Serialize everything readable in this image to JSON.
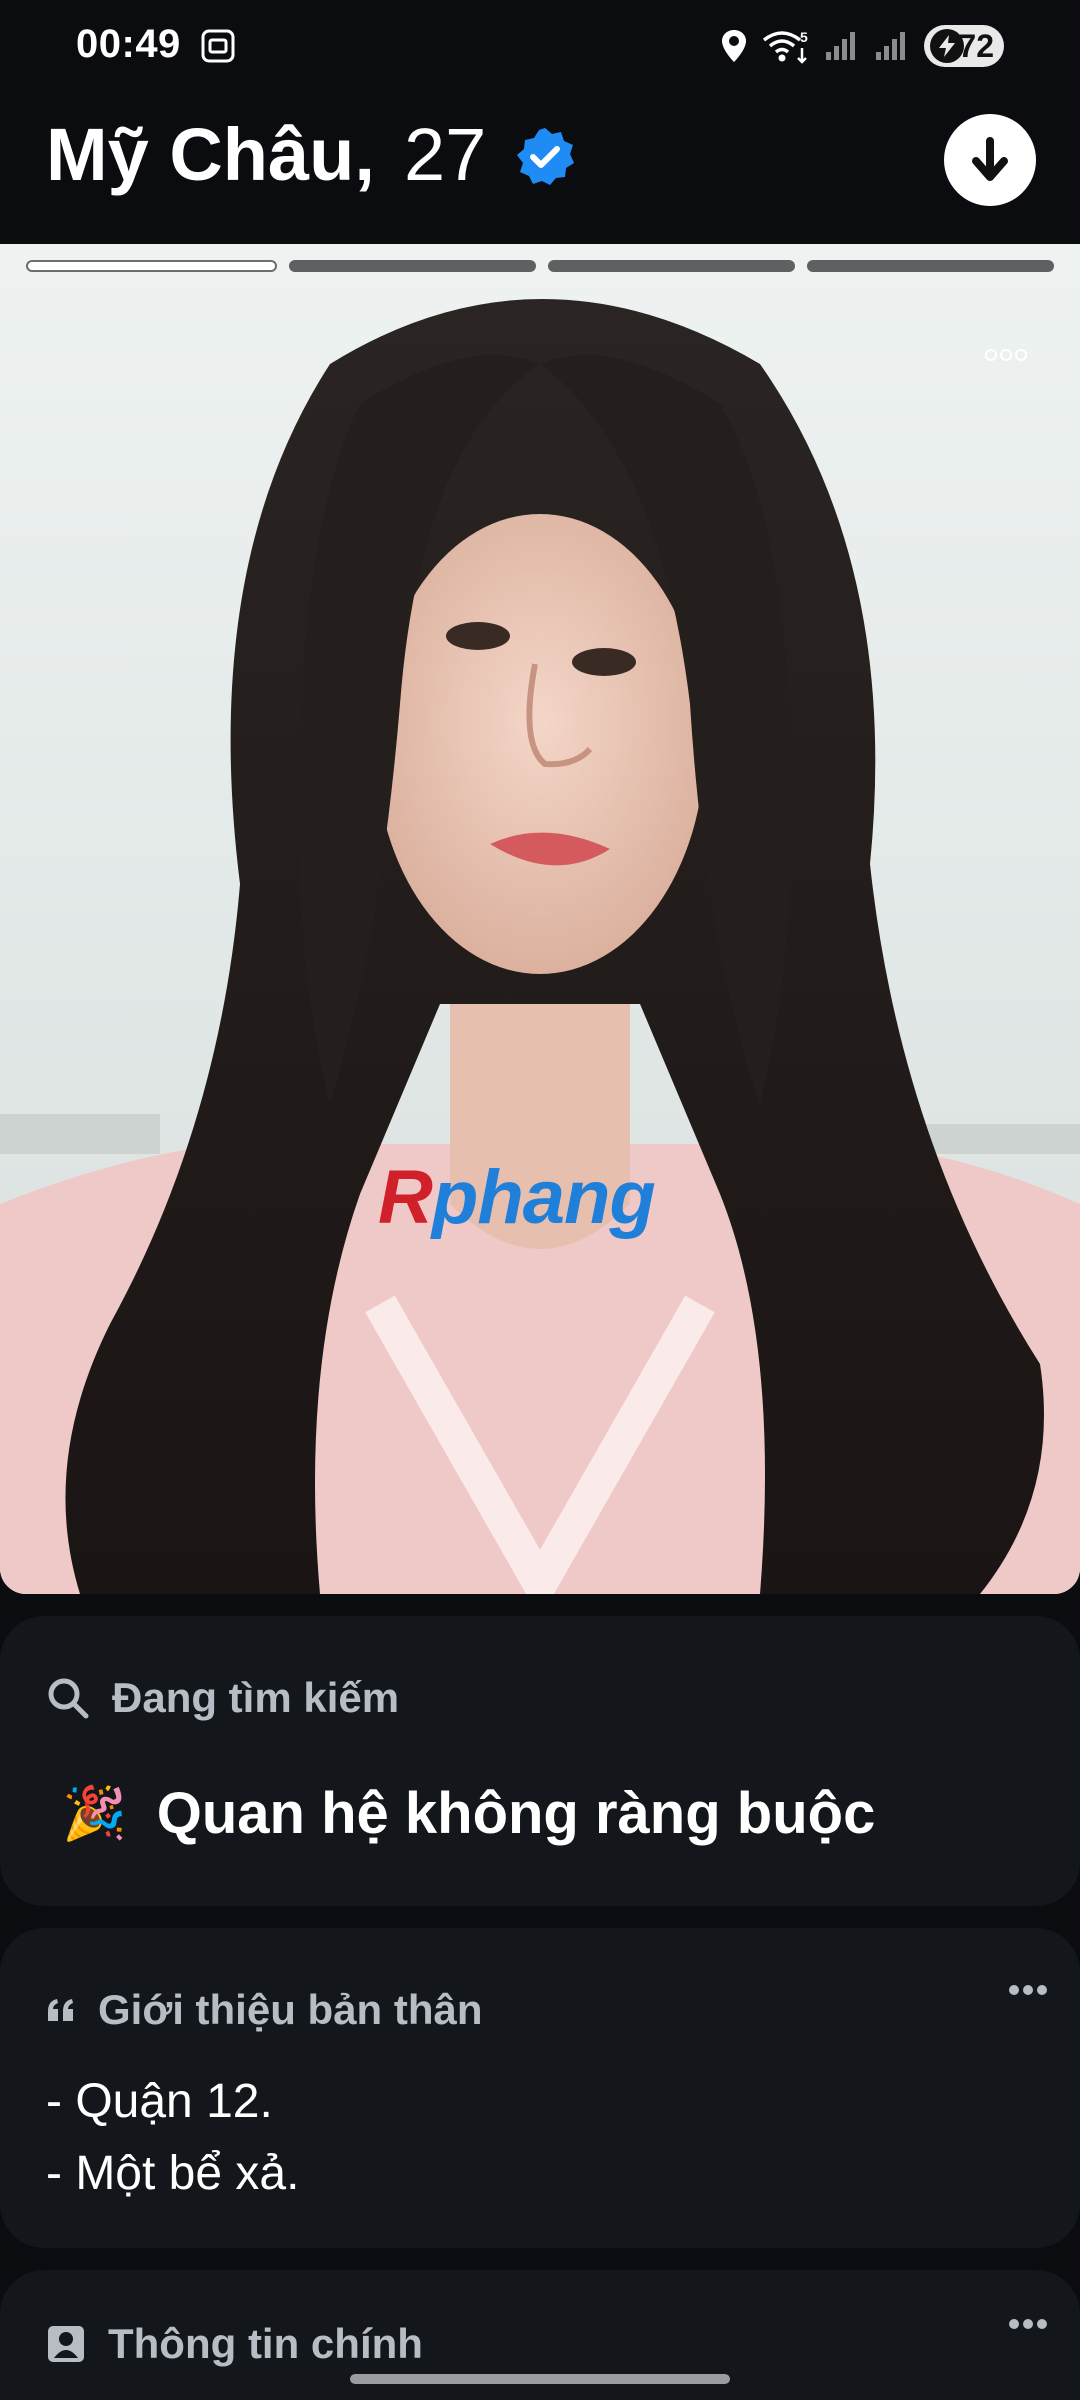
{
  "status_bar": {
    "time": "00:49",
    "wifi_label": "5",
    "battery": "72"
  },
  "header": {
    "name": "Mỹ Châu,",
    "age": "27",
    "verified_color": "#1f8cf5"
  },
  "photo": {
    "count": 4,
    "active_index": 0,
    "watermark_first": "R",
    "watermark_rest": "phang"
  },
  "looking_for": {
    "label": "Đang tìm kiếm",
    "emoji": "🎉",
    "value": "Quan hệ không ràng buộc"
  },
  "about": {
    "label": "Giới thiệu bản thân",
    "lines": [
      "- Quận 12.",
      "- Một bể xả."
    ]
  },
  "basics": {
    "label": "Thông tin chính"
  }
}
